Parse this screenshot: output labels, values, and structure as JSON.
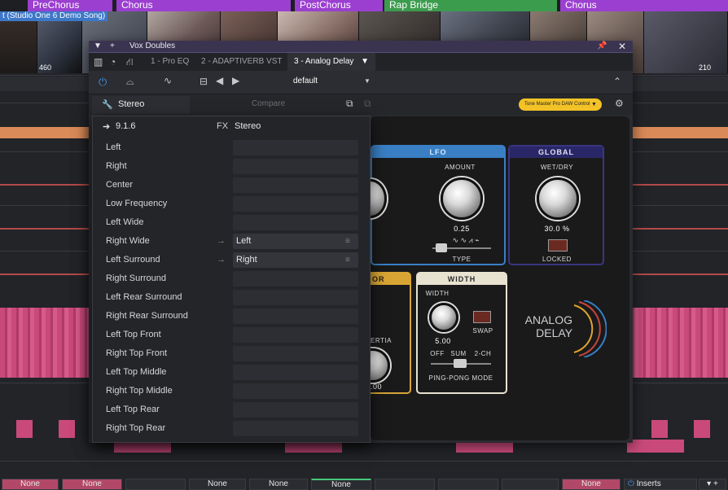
{
  "markers": [
    {
      "label": "PreChorus",
      "color": "#9b3fd0"
    },
    {
      "label": "Chorus",
      "color": "#9b3fd0"
    },
    {
      "label": "PostChorus",
      "color": "#9b3fd0"
    },
    {
      "label": "Rap Bridge",
      "color": "#3c9c4e"
    },
    {
      "label": "Chorus",
      "color": "#9b3fd0"
    }
  ],
  "video_track": {
    "label": "t (Studio One 6 Demo Song)",
    "frame_left": "460",
    "frame_right": "210"
  },
  "plugin": {
    "title": "Vox Doubles",
    "tabs": [
      "1 - Pro EQ",
      "2 - ADAPTIVERB VST",
      "3 - Analog Delay"
    ],
    "preset": "default",
    "channel_mode": "Stereo",
    "compare_label": "Compare",
    "control_link": "Tone Master Pro DAW Control"
  },
  "routing_popup": {
    "header_version": "9.1.6",
    "header_fx": "FX",
    "header_mode": "Stereo",
    "rows": [
      {
        "label": "Left",
        "value": ""
      },
      {
        "label": "Right",
        "value": ""
      },
      {
        "label": "Center",
        "value": ""
      },
      {
        "label": "Low Frequency",
        "value": ""
      },
      {
        "label": "Left Wide",
        "value": ""
      },
      {
        "label": "Right Wide",
        "value": "Left"
      },
      {
        "label": "Left Surround",
        "value": "Right"
      },
      {
        "label": "Right Surround",
        "value": ""
      },
      {
        "label": "Left Rear Surround",
        "value": ""
      },
      {
        "label": "Right Rear Surround",
        "value": ""
      },
      {
        "label": "Left Top Front",
        "value": ""
      },
      {
        "label": "Right Top Front",
        "value": ""
      },
      {
        "label": "Left Top Middle",
        "value": ""
      },
      {
        "label": "Right Top Middle",
        "value": ""
      },
      {
        "label": "Left Top Rear",
        "value": ""
      },
      {
        "label": "Right Top Rear",
        "value": ""
      }
    ]
  },
  "device": {
    "lfo": {
      "title": "LFO",
      "amount_label": "AMOUNT",
      "amount_value": "0.25",
      "type_label": "TYPE"
    },
    "global": {
      "title": "GLOBAL",
      "wetdry_label": "WET/DRY",
      "wetdry_value": "30.0 %",
      "locked_label": "LOCKED"
    },
    "width": {
      "title": "WIDTH",
      "width_label": "WIDTH",
      "width_value": "5.00",
      "swap_label": "SWAP",
      "off": "OFF",
      "sum": "SUM",
      "twoch": "2-CH",
      "pingpong": "PING-PONG MODE"
    },
    "left_section": {
      "title_fragment": "OR",
      "inertia_fragment": "ERTIA",
      "value_fragment": ".00"
    },
    "brand": {
      "line1": "ANALOG",
      "line2": "DELAY"
    }
  },
  "mixer_slots": [
    "None",
    "None",
    "None",
    "None",
    "None",
    "None"
  ],
  "inserts_label": "Inserts"
}
